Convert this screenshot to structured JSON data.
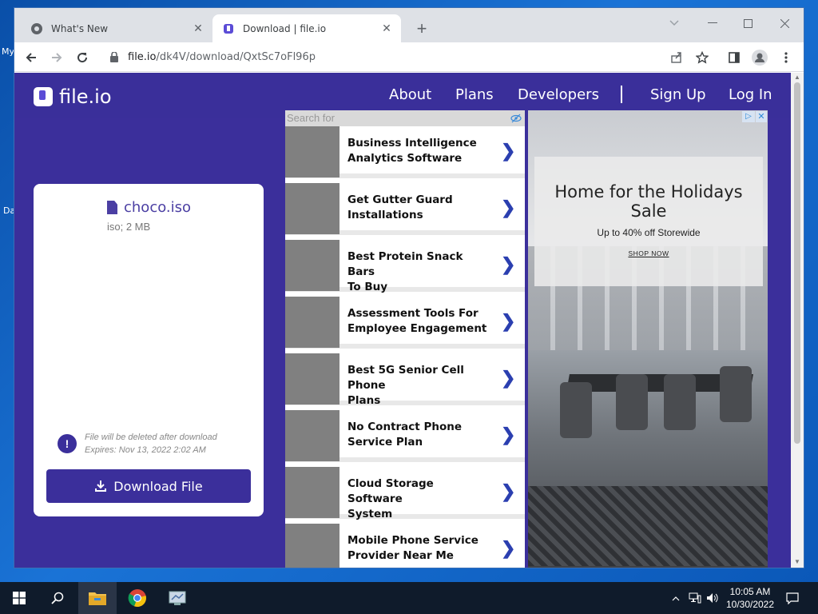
{
  "desktop": {
    "labels": [
      "My",
      "Da"
    ]
  },
  "browser": {
    "tabs": [
      {
        "title": "What's New",
        "favicon": "chrome-icon",
        "active": false
      },
      {
        "title": "Download | file.io",
        "favicon": "fileio-icon",
        "active": true
      }
    ],
    "url": {
      "host": "file.io",
      "path": "/dk4V/download/QxtSc7oFl96p"
    }
  },
  "site": {
    "logo": "file.io",
    "nav": [
      "About",
      "Plans",
      "Developers",
      "Sign Up",
      "Log In"
    ],
    "file": {
      "name": "choco.iso",
      "meta": "iso; 2 MB",
      "notice_line1": "File will be deleted after download",
      "notice_line2": "Expires: Nov 13, 2022 2:02 AM",
      "download_label": "Download File"
    }
  },
  "ads": {
    "search_label": "Search for",
    "items": [
      {
        "line1": "Business Intelligence",
        "line2": "Analytics Software"
      },
      {
        "line1": "Get Gutter Guard",
        "line2": "Installations"
      },
      {
        "line1": "Best Protein Snack Bars",
        "line2": "To Buy"
      },
      {
        "line1": "Assessment Tools For",
        "line2": "Employee Engagement"
      },
      {
        "line1": "Best 5G Senior Cell Phone",
        "line2": "Plans"
      },
      {
        "line1": "No Contract Phone",
        "line2": "Service Plan"
      },
      {
        "line1": "Cloud Storage Software",
        "line2": "System"
      },
      {
        "line1": "Mobile Phone Service",
        "line2": "Provider Near Me"
      }
    ],
    "banner": {
      "headline_line1": "Home for the Holidays",
      "headline_line2": "Sale",
      "sub": "Up to 40% off Storewide",
      "cta": "SHOP NOW",
      "badge": "▷",
      "close": "✕"
    }
  },
  "taskbar": {
    "time": "10:05 AM",
    "date": "10/30/2022"
  }
}
